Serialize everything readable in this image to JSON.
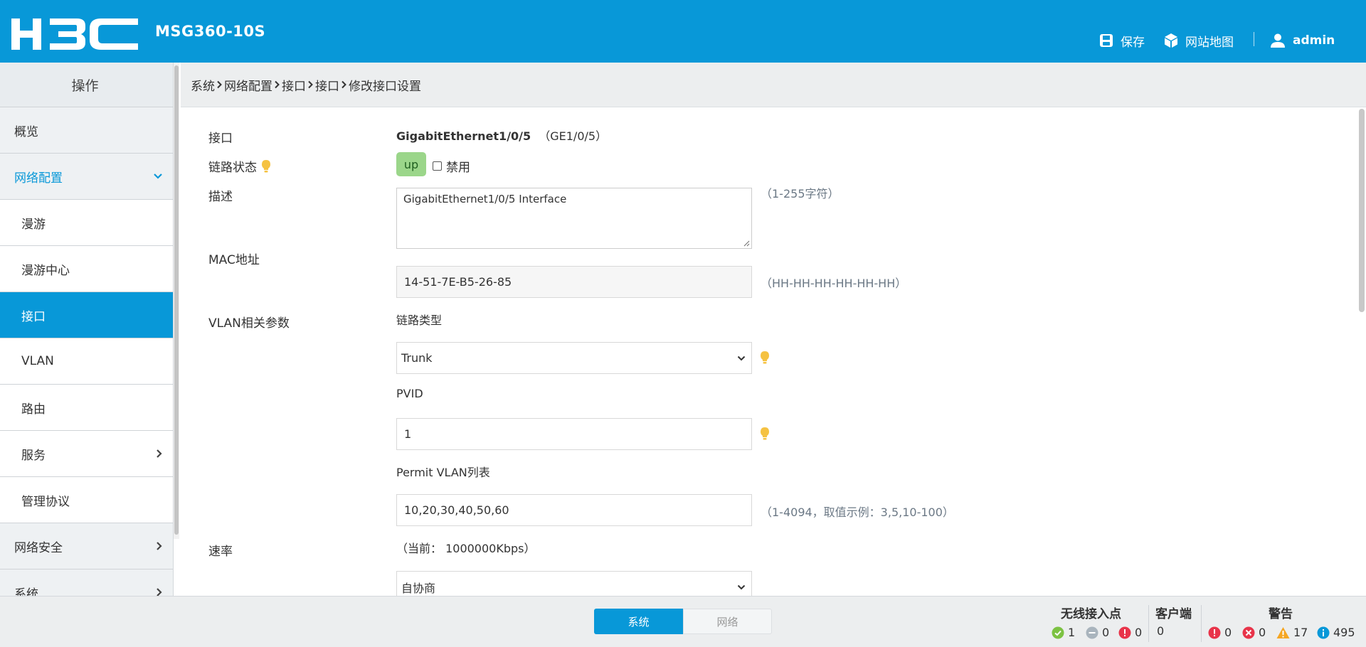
{
  "header": {
    "logo_text": "H3C",
    "model": "MSG360-10S",
    "save_label": "保存",
    "sitemap_label": "网站地图",
    "user_label": "admin",
    "bg_color": "#0898d8"
  },
  "sidebar": {
    "title": "操作",
    "items": [
      {
        "label": "概览",
        "level": 0,
        "state": "normal"
      },
      {
        "label": "网络配置",
        "level": 0,
        "state": "expanded",
        "icon": "chevron-down-icon"
      },
      {
        "label": "漫游",
        "level": 1,
        "state": "normal"
      },
      {
        "label": "漫游中心",
        "level": 1,
        "state": "normal"
      },
      {
        "label": "接口",
        "level": 1,
        "state": "active"
      },
      {
        "label": "VLAN",
        "level": 1,
        "state": "normal"
      },
      {
        "label": "路由",
        "level": 1,
        "state": "normal"
      },
      {
        "label": "服务",
        "level": 1,
        "state": "normal",
        "icon": "chevron-right-icon"
      },
      {
        "label": "管理协议",
        "level": 1,
        "state": "normal"
      },
      {
        "label": "网络安全",
        "level": 0,
        "state": "normal",
        "icon": "chevron-right-icon"
      },
      {
        "label": "系统",
        "level": 0,
        "state": "normal",
        "icon": "chevron-right-icon"
      }
    ]
  },
  "breadcrumb": [
    "系统",
    "网络配置",
    "接口",
    "接口",
    "修改接口设置"
  ],
  "form": {
    "interface": {
      "label": "接口",
      "name": "GigabitEthernet1/0/5",
      "short": "（GE1/0/5）"
    },
    "link_state": {
      "label": "链路状态",
      "status": "up",
      "disable_label": "禁用",
      "disabled": false
    },
    "description": {
      "label": "描述",
      "value": "GigabitEthernet1/0/5 Interface",
      "hint": "（1-255字符）"
    },
    "mac": {
      "label": "MAC地址",
      "value": "14-51-7E-B5-26-85",
      "hint": "（HH-HH-HH-HH-HH-HH）"
    },
    "vlan": {
      "label": "VLAN相关参数",
      "link_type_label": "链路类型",
      "link_type_value": "Trunk",
      "pvid_label": "PVID",
      "pvid_value": "1",
      "permit_label": "Permit VLAN列表",
      "permit_value": "10,20,30,40,50,60",
      "permit_hint": "（1-4094，取值示例：3,5,10-100）"
    },
    "speed": {
      "label": "速率",
      "current": "（当前： 1000000Kbps）",
      "value": "自协商"
    }
  },
  "bottombar": {
    "tabs": [
      {
        "label": "系统",
        "active": true
      },
      {
        "label": "网络",
        "active": false
      }
    ],
    "ap": {
      "title": "无线接入点",
      "online": "1",
      "offline": "0",
      "fault": "0"
    },
    "client": {
      "title": "客户端",
      "count": "0"
    },
    "alarm": {
      "title": "警告",
      "critical": "0",
      "major": "0",
      "minor": "17",
      "info": "495"
    }
  },
  "colors": {
    "accent": "#0898d8",
    "up_badge": "#9bd68a",
    "bulb": "#f5c242"
  }
}
